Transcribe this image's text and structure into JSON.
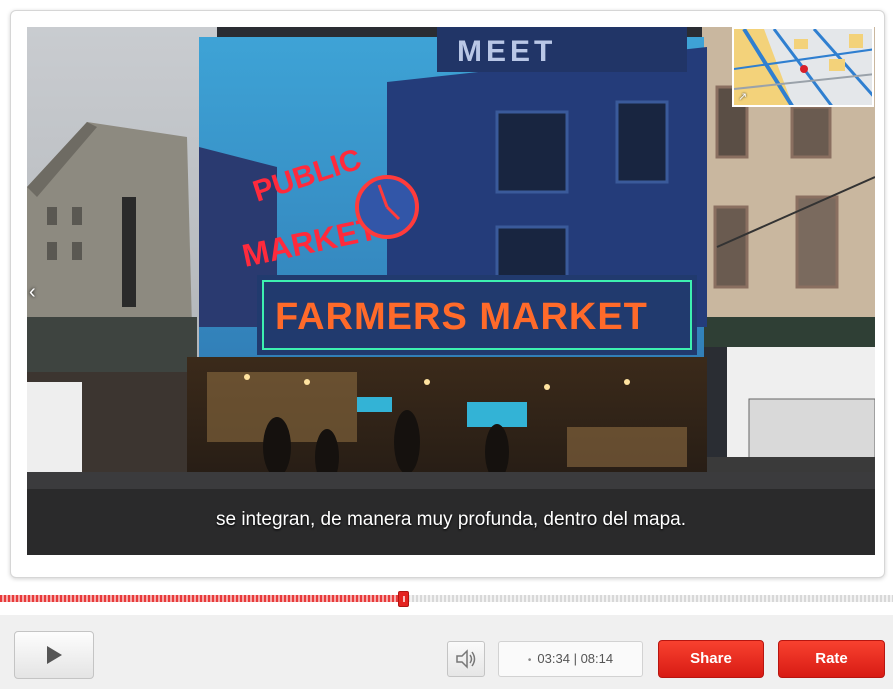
{
  "video": {
    "subtitle": "se integran, de manera muy profunda, dentro del mapa.",
    "sign_public": "PUBLIC",
    "sign_market": "MARKET",
    "sign_farmers": "FARMERS MARKET",
    "sign_meet": "MEET",
    "nav_left_icon": "chevron-left-icon",
    "map_expand_icon": "expand-icon"
  },
  "progress": {
    "played_fraction": 0.451
  },
  "controls": {
    "time_current": "03:34",
    "time_separator": "|",
    "time_total": "08:14",
    "share_label": "Share",
    "rate_label": "Rate"
  },
  "colors": {
    "accent_red": "#e42320",
    "neon_orange": "#ff6a2a",
    "neon_red": "#ff2a3c"
  }
}
